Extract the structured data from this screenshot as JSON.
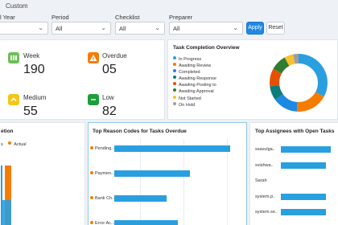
{
  "filters": {
    "custom_label": "Custom",
    "fields": [
      {
        "label": "l Year",
        "value": ""
      },
      {
        "label": "Period",
        "value": "All"
      },
      {
        "label": "Checklist",
        "value": "All"
      },
      {
        "label": "Preparer",
        "value": "All"
      }
    ],
    "apply_label": "Apply",
    "reset_label": "Reset"
  },
  "kpis": [
    {
      "label": "Week",
      "value": "190",
      "icon": "bars-icon",
      "color": "#6cbf5a"
    },
    {
      "label": "Overdue",
      "value": "05",
      "icon": "warning-icon",
      "color": "#f57c00"
    },
    {
      "label": "Medium",
      "value": "55",
      "icon": "chevron-up-icon",
      "color": "#f5c518"
    },
    {
      "label": "Low",
      "value": "82",
      "icon": "minus-icon",
      "color": "#1e9e3a"
    }
  ],
  "task_completion": {
    "title": "Task Completion Overview",
    "legend": [
      {
        "label": "In Progress",
        "color": "#2a9fe0"
      },
      {
        "label": "Awaiting Review",
        "color": "#f57c00"
      },
      {
        "label": "Completed",
        "color": "#1e88e5"
      },
      {
        "label": "Awaiting Response",
        "color": "#0e7c7b"
      },
      {
        "label": "Awaiting Posting to",
        "color": "#e65100"
      },
      {
        "label": "Awaiting Approval",
        "color": "#2e7d32"
      },
      {
        "label": "Not Started",
        "color": "#fbc02d"
      },
      {
        "label": "On Hold",
        "color": "#9e9e9e"
      }
    ],
    "donut": [
      {
        "label": "In Progress",
        "value": 33,
        "color": "#2a9fe0"
      },
      {
        "label": "Awaiting Review",
        "value": 18,
        "color": "#f57c00"
      },
      {
        "label": "Completed",
        "value": 14,
        "color": "#1e88e5"
      },
      {
        "label": "Awaiting Response",
        "value": 8,
        "color": "#0e7c7b"
      },
      {
        "label": "Awaiting Posting to",
        "value": 10,
        "color": "#e65100"
      },
      {
        "label": "Awaiting Approval",
        "value": 9,
        "color": "#2e7d32"
      },
      {
        "label": "Not Started",
        "value": 5,
        "color": "#fbc02d"
      },
      {
        "label": "On Hold",
        "value": 3,
        "color": "#9e9e9e"
      }
    ]
  },
  "left_chart": {
    "title_fragment": "etion",
    "legend_fragment": "s",
    "actual_label": "Actual"
  },
  "reasons": {
    "title": "Top Reason Codes for Tasks Overdue",
    "items": [
      {
        "label": "Pending...",
        "value": 100
      },
      {
        "label": "Paymen...",
        "value": 65
      },
      {
        "label": "Bank Ch...",
        "value": 45
      },
      {
        "label": "Error Ac...",
        "value": 55
      }
    ],
    "max": 125
  },
  "assignees": {
    "title": "Top Assignees with Open Tasks",
    "items": [
      {
        "label": "ssavulga..",
        "value": 100
      },
      {
        "label": "svishwa..",
        "value": 90
      },
      {
        "label": "Sarah",
        "value": 0
      },
      {
        "label": "system.p..",
        "value": 90
      },
      {
        "label": "system.se..",
        "value": 90
      }
    ],
    "max": 100
  }
}
